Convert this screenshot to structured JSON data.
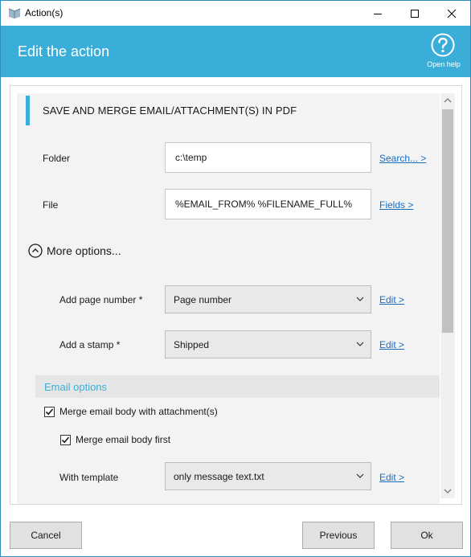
{
  "window": {
    "title": "Action(s)"
  },
  "header": {
    "title": "Edit the action",
    "help_label": "Open help"
  },
  "section": {
    "title": "SAVE AND MERGE EMAIL/ATTACHMENT(S) IN PDF"
  },
  "fields": {
    "folder": {
      "label": "Folder",
      "value": "c:\\temp",
      "link": "Search... >"
    },
    "file": {
      "label": "File",
      "value": "%EMAIL_FROM% %FILENAME_FULL%",
      "link": "Fields >"
    }
  },
  "more_options": {
    "label": "More options..."
  },
  "options": {
    "page_number": {
      "label": "Add page number *",
      "selected": "Page number",
      "link": "Edit >"
    },
    "stamp": {
      "label": "Add a stamp *",
      "selected": "Shipped",
      "link": "Edit >"
    }
  },
  "email_options": {
    "title": "Email options",
    "merge_body": {
      "label": "Merge email body with attachment(s)",
      "checked": true
    },
    "merge_first": {
      "label": "Merge email body first",
      "checked": true
    },
    "template": {
      "label": "With template",
      "selected": "only message text.txt",
      "link": "Edit >"
    }
  },
  "footer": {
    "cancel": "Cancel",
    "previous": "Previous",
    "ok": "Ok"
  },
  "colors": {
    "accent": "#3aaed8",
    "link": "#1a6ec0"
  }
}
